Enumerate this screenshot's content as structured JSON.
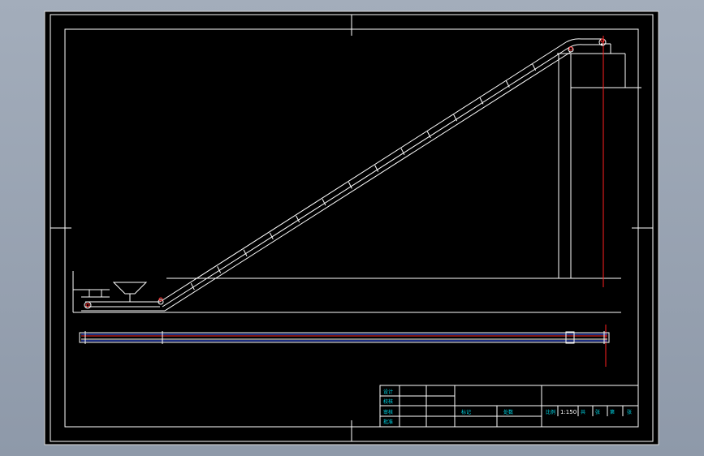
{
  "title_block": {
    "scale": "1:150",
    "left_column": [
      "设计",
      "校核",
      "审核",
      "批准"
    ],
    "mid_labels": [
      "标记",
      "处数"
    ],
    "right_labels": [
      "比例",
      "共",
      "张",
      "第",
      "张"
    ]
  },
  "colors": {
    "background": "#8f9aaa",
    "sheet": "#000000",
    "line": "#ffffff",
    "centerline": "#ff2020",
    "belt_blue": "#3a5cff",
    "text": "#00d8e8"
  }
}
